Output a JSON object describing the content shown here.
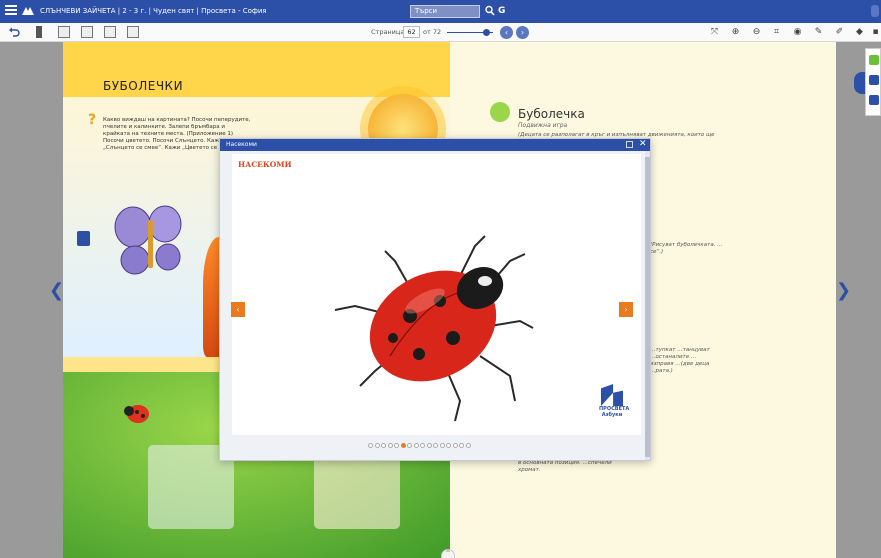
{
  "app": {
    "title": "СЛЪНЧЕВИ ЗАЙЧЕТА | 2 - 3 г. | Чуден свят | Просвета - София",
    "search_placeholder": "Търси",
    "google_label": "G"
  },
  "toolbar": {
    "page_label": "Страница",
    "page_value": "62",
    "page_total": "от 72",
    "page_progress": 0.86
  },
  "book": {
    "left_page": {
      "heading": "БУБОЛЕЧКИ",
      "task_text": "Какво виждаш на картината? Посочи пеперудите, пчелите и калинките. Залепи бръмбара и крайката на техните места. (Приложение 1) Посочи цветето. Посочи Слънцето. Кажи „Слънцето се смее“. Кажи „Цветето се смее“."
    },
    "right_page": {
      "title": "Буболечка",
      "subtitle": "Подвижна игра",
      "text_1": "(Децата се разполагат в кръг и изпълняват движенията, които ще обявява…",
      "text_2": "(Рисуват буболечката. …се“.)",
      "text_3": "…тупкат …танцуват …останалите …изправя …(две деца …рата.)",
      "text_4": "в основната позиция. …спечели хромат."
    }
  },
  "modal": {
    "header_title": "Насекоми",
    "slide_title": "НАСЕКОМИ",
    "close_symbol": "✕",
    "prev_symbol": "‹",
    "next_symbol": "›",
    "publisher": "ПРОСВЕТА",
    "publisher_sub": "Азбуки",
    "slides_total": 16,
    "active_slide": 6
  },
  "icons": {
    "menu": "menu-icon",
    "search": "search-icon",
    "zoom_in": "zoom-in-icon",
    "zoom_out": "zoom-out-icon",
    "crop": "crop-icon",
    "pen": "pen-icon",
    "eraser": "eraser-icon"
  },
  "colors": {
    "primary": "#2c4fa8",
    "accent": "#e97a1e",
    "slide_title": "#e0421b"
  }
}
